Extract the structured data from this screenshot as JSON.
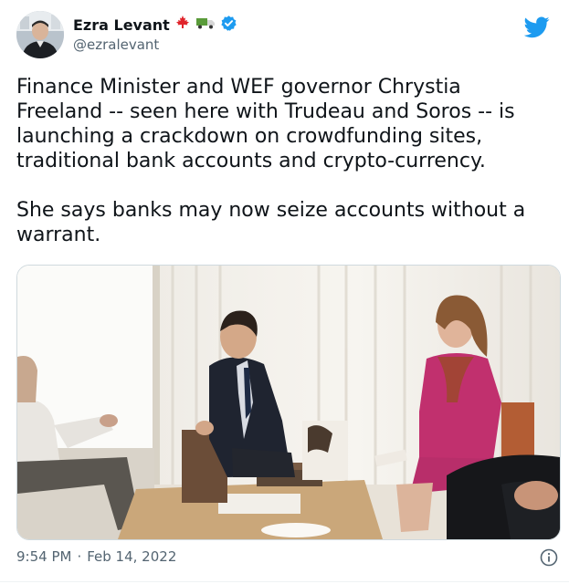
{
  "author": {
    "display_name": "Ezra Levant",
    "handle": "@ezralevant",
    "verified": true,
    "badge_emojis": [
      "maple-leaf",
      "truck"
    ]
  },
  "tweet": {
    "text": "Finance Minister and WEF governor Chrystia\nFreeland -- seen here with Trudeau and Soros -- is\nlaunching a crackdown on crowdfunding sites,\ntraditional bank accounts and crypto-currency.\n\nShe says banks may now seize accounts without a\nwarrant.",
    "time": "9:54 PM",
    "separator": "·",
    "date": "Feb 14, 2022"
  },
  "colors": {
    "twitter_blue": "#1d9bf0",
    "text": "#0f1419",
    "muted": "#536471",
    "maple_red": "#e0242b",
    "truck_green": "#5a9b3a"
  },
  "icons": {
    "logo": "twitter-bird-icon",
    "verified": "verified-badge-icon",
    "info": "info-icon"
  }
}
